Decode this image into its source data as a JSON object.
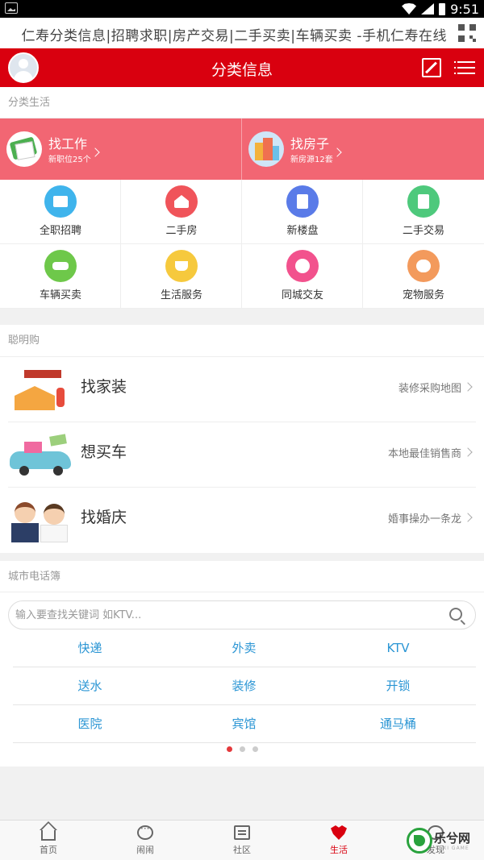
{
  "status_bar": {
    "time": "9:51"
  },
  "page_title": "仁寿分类信息|招聘求职|房产交易|二手买卖|车辆买卖 -手机仁寿在线",
  "header": {
    "title": "分类信息"
  },
  "sections": {
    "life": "分类生活",
    "smart_buy": "聪明购",
    "phonebook": "城市电话簿"
  },
  "banner": [
    {
      "title": "找工作",
      "subtitle": "新职位25个"
    },
    {
      "title": "找房子",
      "subtitle": "新房源12套"
    }
  ],
  "grid": [
    {
      "label": "全职招聘",
      "icon": "briefcase-icon",
      "color": "#3fb4ec"
    },
    {
      "label": "二手房",
      "icon": "house-search-icon",
      "color": "#f0545a"
    },
    {
      "label": "新楼盘",
      "icon": "building-icon",
      "color": "#5a7be8"
    },
    {
      "label": "二手交易",
      "icon": "receipt-icon",
      "color": "#4ec97c"
    },
    {
      "label": "车辆买卖",
      "icon": "car-icon",
      "color": "#6ec84a"
    },
    {
      "label": "生活服务",
      "icon": "coffee-icon",
      "color": "#f6c93d"
    },
    {
      "label": "同城交友",
      "icon": "heart-icon",
      "color": "#f2528d"
    },
    {
      "label": "宠物服务",
      "icon": "dog-icon",
      "color": "#f39a5c"
    }
  ],
  "shop": [
    {
      "title": "找家装",
      "subtitle": "装修采购地图"
    },
    {
      "title": "想买车",
      "subtitle": "本地最佳销售商"
    },
    {
      "title": "找婚庆",
      "subtitle": "婚事操办一条龙"
    }
  ],
  "search": {
    "placeholder": "输入要查找关键词 如KTV..."
  },
  "phone_rows": [
    [
      "快递",
      "外卖",
      "KTV"
    ],
    [
      "送水",
      "装修",
      "开锁"
    ],
    [
      "医院",
      "宾馆",
      "通马桶"
    ]
  ],
  "pager": {
    "pages": 3,
    "active": 1
  },
  "nav": [
    {
      "label": "首页",
      "icon": "home-icon"
    },
    {
      "label": "闹闹",
      "icon": "chat-icon"
    },
    {
      "label": "社区",
      "icon": "community-icon"
    },
    {
      "label": "生活",
      "icon": "life-icon",
      "active": true
    },
    {
      "label": "发现",
      "icon": "discover-icon"
    }
  ],
  "watermark": {
    "text": "乐兮网",
    "sub": "LEXI GAME"
  }
}
